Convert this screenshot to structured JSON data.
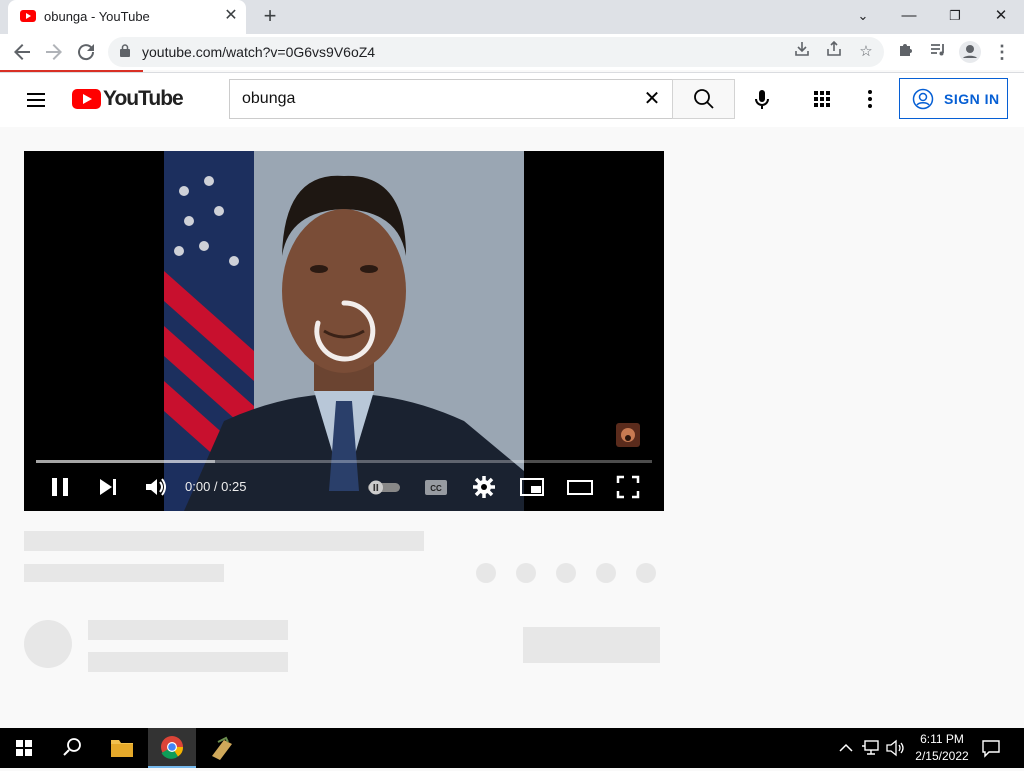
{
  "browser": {
    "tab_title": "obunga - YouTube",
    "url": "youtube.com/watch?v=0G6vs9V6oZ4",
    "tab_close_icon": "close-icon",
    "new_tab_icon": "plus-icon"
  },
  "youtube": {
    "logo_text": "YouTube",
    "search_value": "obunga",
    "signin_label": "SIGN IN",
    "brand_color": "#ff0000",
    "accent_color": "#065fd4"
  },
  "player": {
    "time": "0:00 / 0:25",
    "state": "loading",
    "autoplay_toggle": "off",
    "loaded_fraction": 0.29
  },
  "taskbar": {
    "time": "6:11 PM",
    "date": "2/15/2022"
  }
}
